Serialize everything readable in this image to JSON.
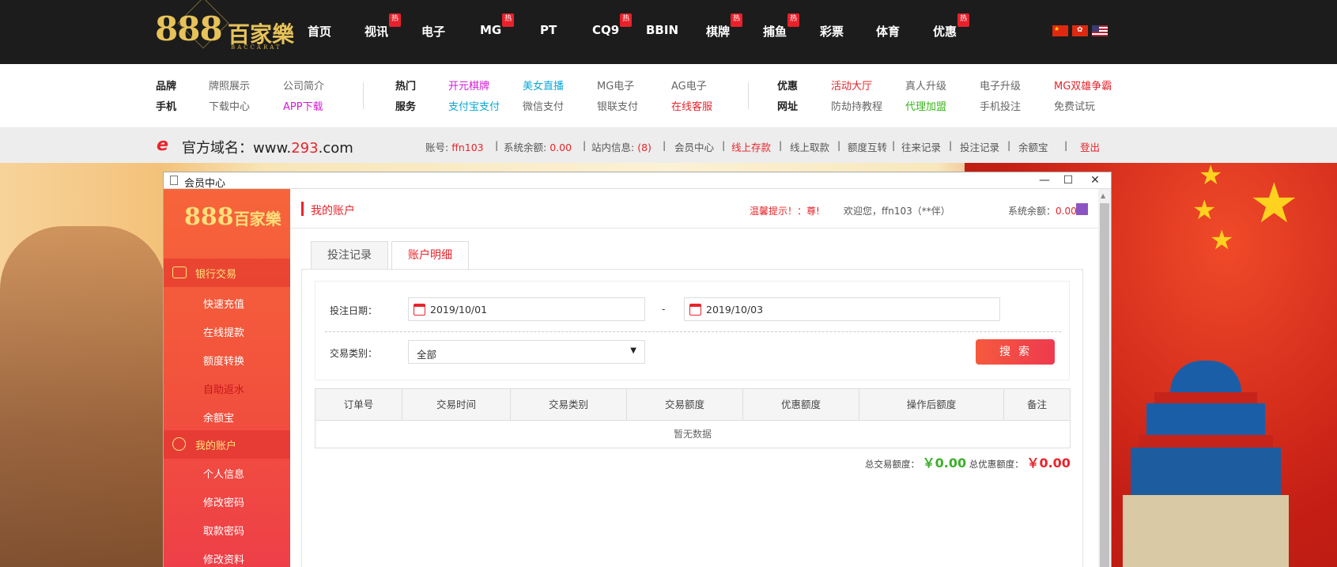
{
  "logo": {
    "number": "888",
    "text": "百家樂",
    "sub": "BACCARAT"
  },
  "nav": [
    {
      "label": "首页",
      "hot": false
    },
    {
      "label": "视讯",
      "hot": true
    },
    {
      "label": "电子",
      "hot": false
    },
    {
      "label": "MG",
      "hot": true
    },
    {
      "label": "PT",
      "hot": false
    },
    {
      "label": "CQ9",
      "hot": true
    },
    {
      "label": "BBIN",
      "hot": false
    },
    {
      "label": "棋牌",
      "hot": true
    },
    {
      "label": "捕鱼",
      "hot": true
    },
    {
      "label": "彩票",
      "hot": false
    },
    {
      "label": "体育",
      "hot": false
    },
    {
      "label": "优惠",
      "hot": true
    }
  ],
  "hot_badge": "热",
  "flags": [
    "flag-cn-icon",
    "flag-hk-icon",
    "flag-us-icon"
  ],
  "submenu": {
    "brand": "品牌",
    "mobile": "手机",
    "license": "牌照展示",
    "about": "公司简介",
    "download": "下载中心",
    "app": "APP下载",
    "hot": "热门",
    "service": "服务",
    "kaiyuan": "开元棋牌",
    "live": "美女直播",
    "mg": "MG电子",
    "ag": "AG电子",
    "alipay": "支付宝支付",
    "wechat": "微信支付",
    "unionpay": "银联支付",
    "cs": "在线客服",
    "promo": "优惠",
    "site": "网址",
    "hall": "活动大厅",
    "real_up": "真人升级",
    "elec_up": "电子升级",
    "mg_battle": "MG双雄争霸",
    "anti": "防劫持教程",
    "agent": "代理加盟",
    "mobile_bet": "手机投注",
    "trial": "免费试玩"
  },
  "domainbar": {
    "label": "官方域名：",
    "prefix": "www.",
    "highlight": "293",
    "suffix": ".com",
    "account_label": "账号:",
    "account": "ffn103",
    "balance_label": "系统余额:",
    "balance": "0.00",
    "msg_label": "站内信息:",
    "msg_count": "(8)",
    "links": [
      "会员中心",
      "线上存款",
      "线上取款",
      "额度互转",
      "往来记录",
      "投注记录",
      "余额宝"
    ],
    "logout": "登出"
  },
  "window": {
    "title": "会员中心",
    "controls": [
      "—",
      "☐",
      "✕"
    ]
  },
  "sidebar": {
    "logo_num": "888",
    "logo_cn": "百家樂",
    "section_bank": "银行交易",
    "bank_items": [
      "快速充值",
      "在线提款",
      "额度转换",
      "自助返水",
      "余额宝"
    ],
    "section_account": "我的账户",
    "account_items": [
      "个人信息",
      "修改密码",
      "取款密码",
      "修改资料"
    ]
  },
  "main": {
    "title": "我的账户",
    "tip": "温馨提示！：尊!",
    "welcome": "欢迎您，ffn103（**伴）",
    "balance_label": "系统余额：",
    "balance": "0.00",
    "tabs": [
      "投注记录",
      "账户明细"
    ],
    "date_label": "投注日期：",
    "date_from": "2019/10/01",
    "date_sep": "-",
    "date_to": "2019/10/03",
    "type_label": "交易类别：",
    "type_value": "全部",
    "search": "搜索",
    "columns": [
      "订单号",
      "交易时间",
      "交易类别",
      "交易额度",
      "优惠额度",
      "操作后额度",
      "备注"
    ],
    "no_data": "暂无数据",
    "total_trade_label": "总交易额度：",
    "total_trade": "￥0.00",
    "total_promo_label": "总优惠额度：",
    "total_promo": "￥0.00"
  }
}
